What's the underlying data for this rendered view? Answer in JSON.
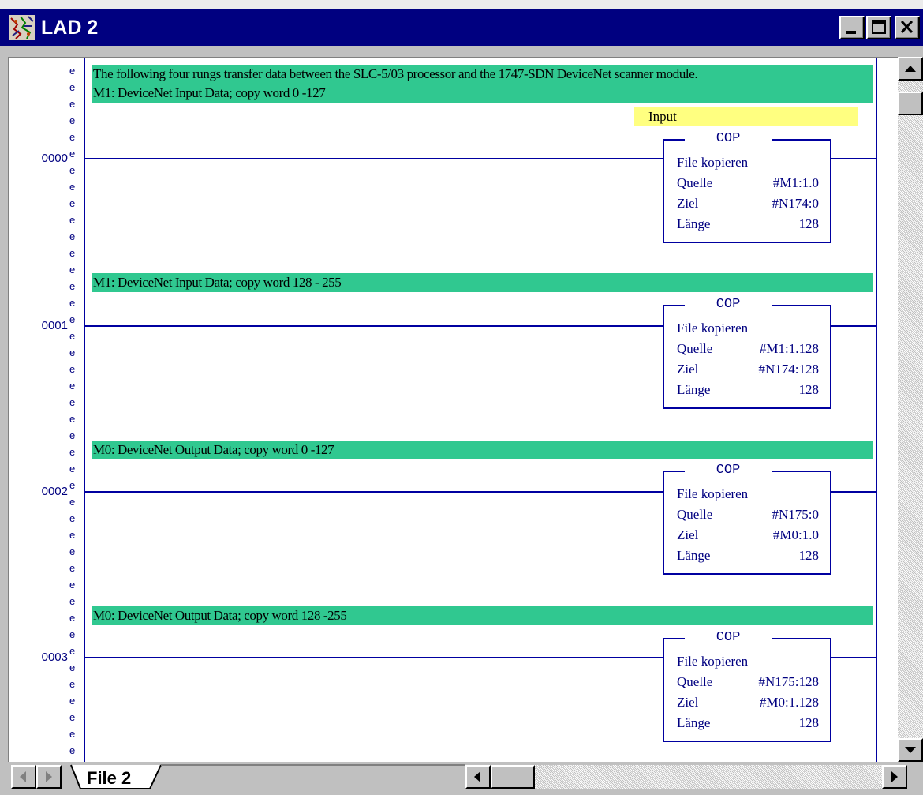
{
  "window": {
    "title": "LAD 2",
    "buttons": [
      "minimize",
      "maximize",
      "close"
    ]
  },
  "ladder": {
    "top_comment": "The following four rungs transfer data between the SLC-5/03 processor and the 1747-SDN DeviceNet scanner module.",
    "yellow_label": "Input",
    "rungs": [
      {
        "number": "0000",
        "comment": "M1: DeviceNet Input Data; copy word 0 -127",
        "instruction": {
          "mnemonic": "COP",
          "name": "File kopieren",
          "source_label": "Quelle",
          "source": "#M1:1.0",
          "dest_label": "Ziel",
          "dest": "#N174:0",
          "length_label": "Länge",
          "length": "128"
        }
      },
      {
        "number": "0001",
        "comment": "M1: DeviceNet Input Data; copy word 128 - 255",
        "instruction": {
          "mnemonic": "COP",
          "name": "File kopieren",
          "source_label": "Quelle",
          "source": "#M1:1.128",
          "dest_label": "Ziel",
          "dest": "#N174:128",
          "length_label": "Länge",
          "length": "128"
        }
      },
      {
        "number": "0002",
        "comment": "M0: DeviceNet Output Data; copy word 0 -127",
        "instruction": {
          "mnemonic": "COP",
          "name": "File kopieren",
          "source_label": "Quelle",
          "source": "#N175:0",
          "dest_label": "Ziel",
          "dest": "#M0:1.0",
          "length_label": "Länge",
          "length": "128"
        }
      },
      {
        "number": "0003",
        "comment": "M0: DeviceNet Output Data; copy word 128 -255",
        "instruction": {
          "mnemonic": "COP",
          "name": "File kopieren",
          "source_label": "Quelle",
          "source": "#N175:128",
          "dest_label": "Ziel",
          "dest": "#M0:1.128",
          "length_label": "Länge",
          "length": "128"
        }
      }
    ],
    "edit_marker": "e"
  },
  "tabs": [
    {
      "label": "File 2",
      "active": true
    }
  ],
  "colors": {
    "titlebar": "#000080",
    "comment_bg": "#30c890",
    "label_bg": "#ffff80",
    "ladder_ink": "#0000a0"
  }
}
